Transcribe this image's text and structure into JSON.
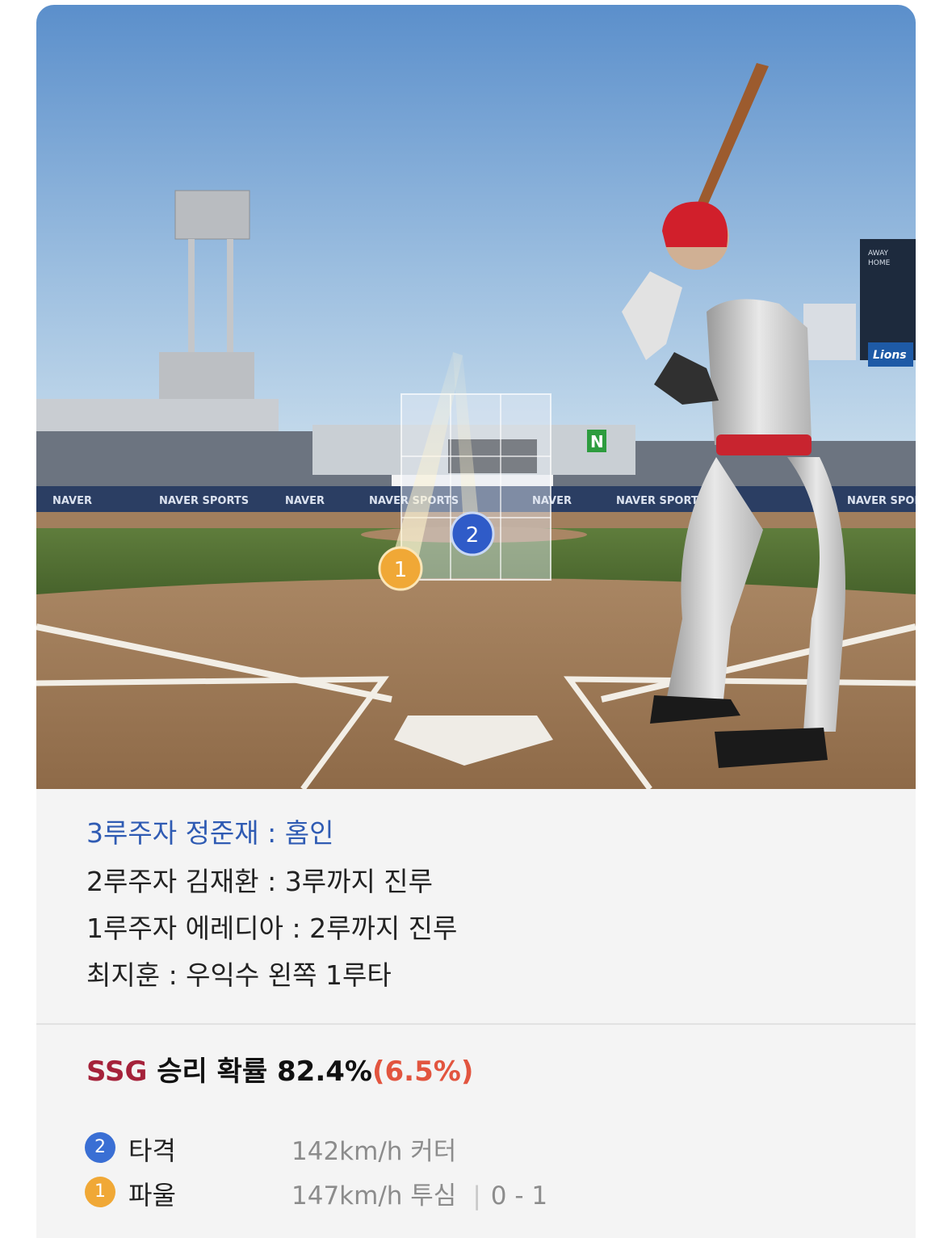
{
  "colors": {
    "event_highlight": "#2f5bb3",
    "team": "#a5223a",
    "delta": "#e2553f",
    "badge_hit": "#3a6fd4",
    "badge_foul": "#f0a836"
  },
  "scene": {
    "ad_boards": [
      "NAVER",
      "NAVER SPORTS",
      "NAVER",
      "NAVER SPORTS",
      "NAVER",
      "NAVER SPORTS",
      "NAVER SPORTS"
    ],
    "sign_letter": "N",
    "scoreboard": [
      "AWAY",
      "HOME"
    ],
    "logo": "Lions",
    "pitch_markers": [
      "1",
      "2"
    ]
  },
  "events": [
    "3루주자 정준재 : 홈인",
    "2루주자 김재환 : 3루까지 진루",
    "1루주자 에레디아 : 2루까지 진루",
    "최지훈 : 우익수 왼쪽 1루타"
  ],
  "win_probability": {
    "team": "SSG",
    "label": "승리 확률",
    "value": "82.4%",
    "delta": "(6.5%)"
  },
  "pitches": [
    {
      "number": "2",
      "result": "타격",
      "speed": "142km/h",
      "type": "커터",
      "count": "",
      "badge_icon": "pitch-number-badge-blue"
    },
    {
      "number": "1",
      "result": "파울",
      "speed": "147km/h",
      "type": "투심",
      "count": "0 - 1",
      "badge_icon": "pitch-number-badge-orange"
    }
  ]
}
